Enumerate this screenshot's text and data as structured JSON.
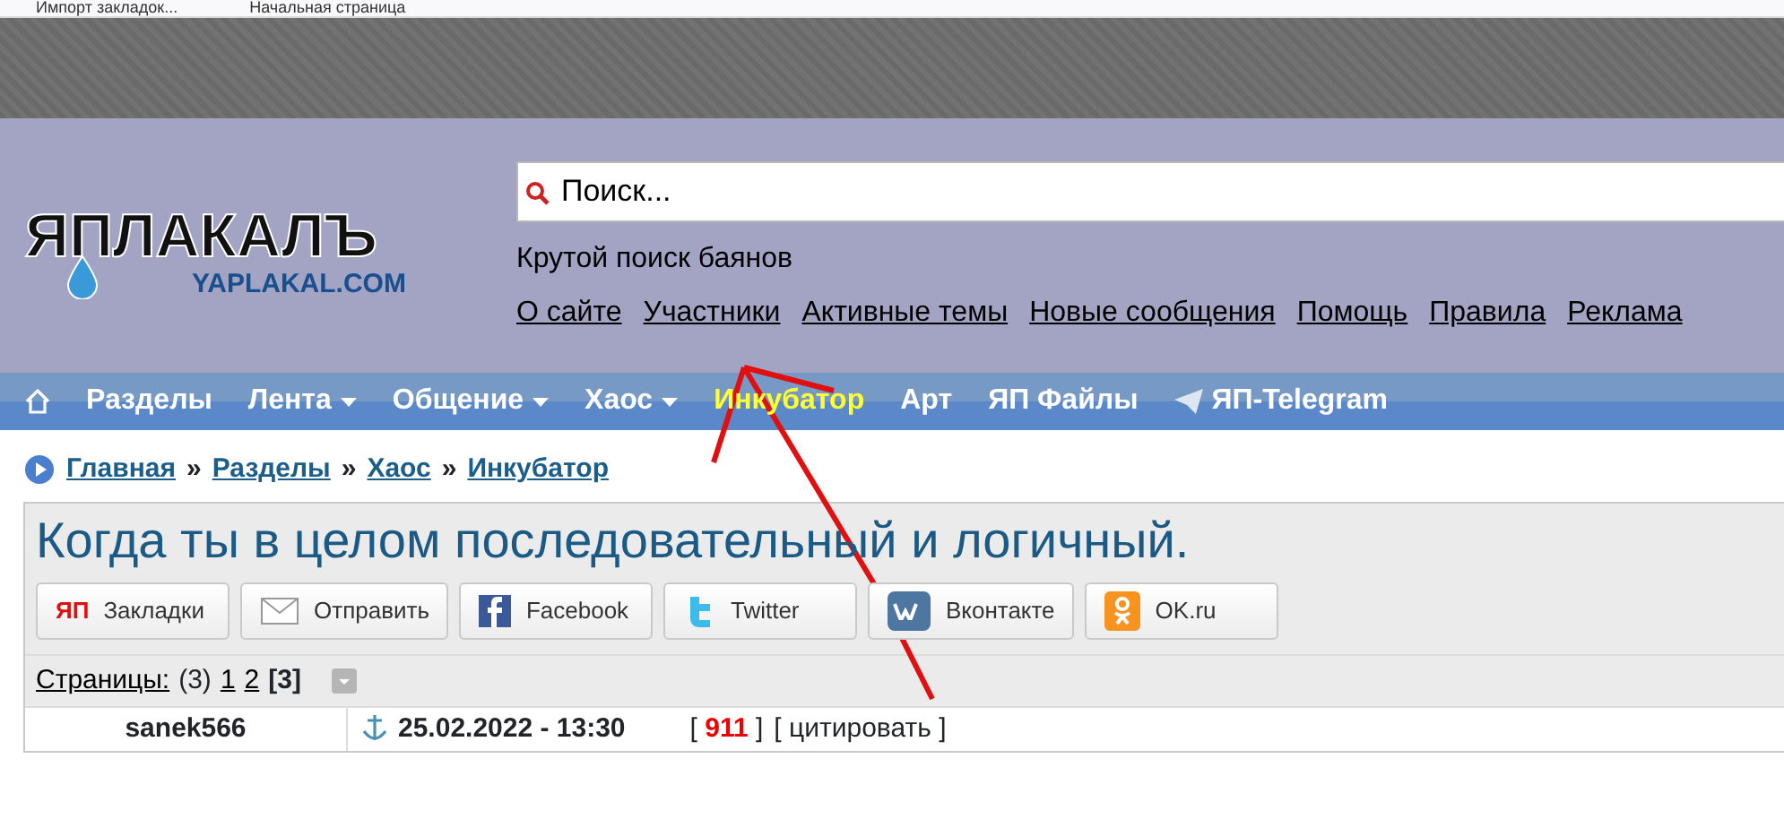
{
  "browser_bookmarks": [
    "Импорт закладок...",
    "Начальная страница"
  ],
  "logo": {
    "title": "ЯПЛАКАЛЪ",
    "subtitle": "YAPLAKAL.COM"
  },
  "search": {
    "placeholder": "Поиск..."
  },
  "search_caption": "Крутой поиск баянов",
  "top_links": [
    "О сайте",
    "Участники",
    "Активные темы",
    "Новые сообщения",
    "Помощь",
    "Правила",
    "Реклама"
  ],
  "nav": [
    {
      "label": "Разделы",
      "dropdown": false,
      "highlight": false
    },
    {
      "label": "Лента",
      "dropdown": true,
      "highlight": false
    },
    {
      "label": "Общение",
      "dropdown": true,
      "highlight": false
    },
    {
      "label": "Хаос",
      "dropdown": true,
      "highlight": false
    },
    {
      "label": "Инкубатор",
      "dropdown": false,
      "highlight": true
    },
    {
      "label": "Арт",
      "dropdown": false,
      "highlight": false
    },
    {
      "label": "ЯП Файлы",
      "dropdown": false,
      "highlight": false
    },
    {
      "label": "ЯП-Telegram",
      "dropdown": false,
      "highlight": false,
      "kind": "telegram"
    }
  ],
  "breadcrumb": [
    "Главная",
    "Разделы",
    "Хаос",
    "Инкубатор"
  ],
  "breadcrumb_separator": "»",
  "topic_title": "Когда ты в целом последовательный и логичный.",
  "share_buttons": [
    {
      "kind": "yap",
      "icon_text": "ЯП",
      "label": "Закладки"
    },
    {
      "kind": "mail",
      "label": "Отправить"
    },
    {
      "kind": "facebook",
      "label": "Facebook"
    },
    {
      "kind": "twitter",
      "label": "Twitter"
    },
    {
      "kind": "vk",
      "label": "Вконтакте"
    },
    {
      "kind": "ok",
      "label": "OK.ru"
    }
  ],
  "pages": {
    "label": "Страницы:",
    "count": "(3)",
    "items": [
      {
        "label": "1",
        "selected": false
      },
      {
        "label": "2",
        "selected": false
      },
      {
        "label": "[3]",
        "selected": true
      }
    ]
  },
  "post": {
    "author": "sanek566",
    "date": "25.02.2022 - 13:30",
    "rating": "911",
    "quote": "цитировать",
    "bracket_open": "[",
    "bracket_close": "]"
  }
}
